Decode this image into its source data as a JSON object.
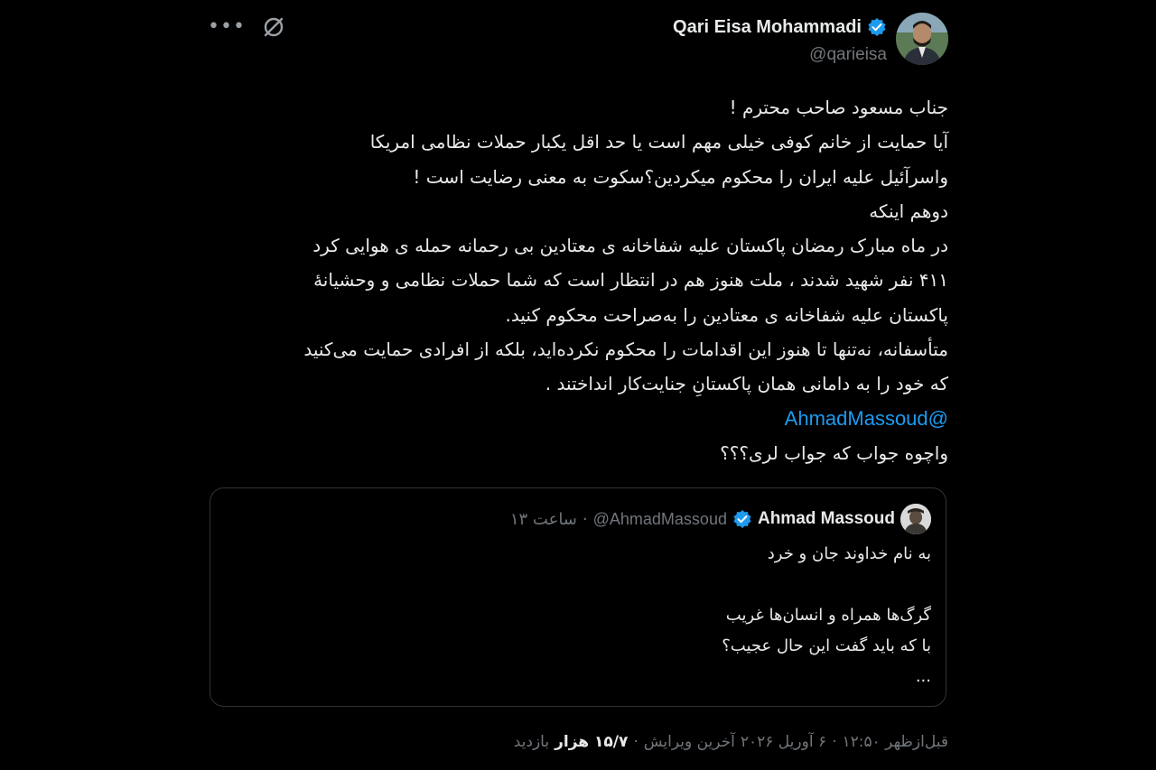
{
  "author": {
    "display_name": "Qari Eisa Mohammadi",
    "handle": "@qarieisa",
    "verified_color": "#1d9bf0"
  },
  "icons": {
    "more": "more-horizontal-icon",
    "grok": "grok-icon",
    "verified": "verified-badge-icon"
  },
  "body_lines": [
    "جناب مسعود صاحب محترم !",
    "آیا حمایت از خانم کوفی خیلی مهم است یا حد اقل یکبار حملات نظامی امریکا",
    "واسرآئیل علیه ایران را محکوم میکردین؟سکوت به معنی رضایت است !",
    "دوهم اینکه",
    "در ماه مبارک رمضان پاکستان علیه شفاخانه ی معتادین بی رحمانه حمله ی هوایی کرد",
    "۴۱۱ نفر شهید شدند ، ملت هنوز هم در انتظار است که شما حملات نظامی و وحشیانهٔ",
    "پاکستان علیه شفاخانه ی معتادین را به‌صراحت محکوم کنید.",
    "متأسفانه، نه‌تنها تا هنوز این اقدامات را محکوم نکرده‌اید، بلکه از افرادی حمایت می‌کنید",
    "که خود را به دامانی همان پاکستانِ جنایت‌کار انداختند ."
  ],
  "mention": "@AhmadMassoud",
  "last_line": "واچوه جواب که جواب لری؟؟؟",
  "quote": {
    "display_name": "Ahmad Massoud",
    "handle": "@AhmadMassoud",
    "time": "ساعت ۱۳",
    "separator": "·",
    "lines": [
      "به نام خداوند جان و خرد",
      "",
      "گرگ‌ها همراه و انسان‌ها غریب",
      "با که باید گفت این حال عجیب؟",
      "..."
    ]
  },
  "footer": {
    "time": "قبل‌ازظهر ۱۲:۵۰",
    "date": "۶ آوریل ۲۰۲۶",
    "edited": "آخرین ویرایش",
    "views_count": "۱۵/۷ هزار",
    "views_label": "بازدید",
    "separator": "·"
  }
}
